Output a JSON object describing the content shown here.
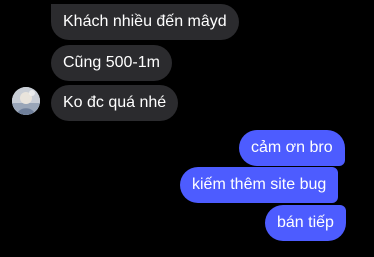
{
  "incoming": [
    {
      "text": "Khách nhiều đến mâyd"
    },
    {
      "text": "Cũng 500-1m"
    },
    {
      "text": "Ko đc quá nhé"
    }
  ],
  "outgoing": [
    {
      "text": "cảm ơn bro"
    },
    {
      "text": "kiếm thêm site bug"
    },
    {
      "text": "bán tiếp"
    }
  ],
  "colors": {
    "background": "#000000",
    "incoming_bubble": "#2b2b2e",
    "outgoing_bubble": "#4d5cff",
    "text": "#ffffff"
  },
  "avatar_icon": "profile-photo"
}
